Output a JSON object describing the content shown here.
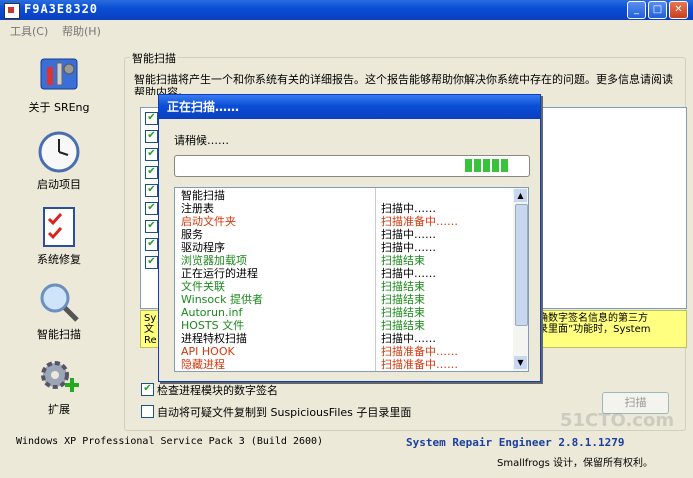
{
  "window": {
    "title": "F9A3E8320",
    "min_glyph": "_",
    "max_glyph": "□",
    "close_glyph": "✕"
  },
  "menu": [
    "工具(C)",
    "帮助(H)"
  ],
  "sidebar": [
    {
      "label": "关于 SREng",
      "icon": "about-tools-icon"
    },
    {
      "label": "启动项目",
      "icon": "clock-icon"
    },
    {
      "label": "系统修复",
      "icon": "checklist-icon"
    },
    {
      "label": "智能扫描",
      "icon": "magnifier-icon"
    },
    {
      "label": "扩展",
      "icon": "gear-plus-icon"
    }
  ],
  "main": {
    "group_title": "智能扫描",
    "intro": "智能扫描将产生一个和你系统有关的详细报告。这个报告能够帮助你解决你系统中存在的问题。更多信息请阅读帮助内容。",
    "yellow_note": {
      "line1_left": "Sy",
      "line1_right": "确数字签名信息的第三方",
      "line2_left": "文",
      "line2_right": "录里面”功能时，System",
      "line3_left": "Re"
    },
    "option_signature": "检查进程模块的数字签名",
    "option_copy": "自动将可疑文件复制到 SuspiciousFiles 子目录里面",
    "scan_button": "扫描"
  },
  "status": {
    "os": "Windows XP Professional Service Pack 3 (Build 2600)",
    "product": "System Repair Engineer 2.8.1.1279",
    "credit": "Smallfrogs 设计，保留所有权利。",
    "watermark": "51CTO.com"
  },
  "dialog": {
    "title": "正在扫描……",
    "wait": "请稍候……",
    "progress": 0.2,
    "rows": [
      {
        "name": "智能扫描",
        "status": "",
        "color": "#000000"
      },
      {
        "name": "注册表",
        "status": "扫描中……",
        "color": "#000000"
      },
      {
        "name": "启动文件夹",
        "status": "扫描准备中……",
        "color": "#d4380d"
      },
      {
        "name": "服务",
        "status": "扫描中……",
        "color": "#000000"
      },
      {
        "name": "驱动程序",
        "status": "扫描中……",
        "color": "#000000"
      },
      {
        "name": "浏览器加载项",
        "status": "扫描结束",
        "color": "#1a8a1a"
      },
      {
        "name": "正在运行的进程",
        "status": "扫描中……",
        "color": "#000000"
      },
      {
        "name": "文件关联",
        "status": "扫描结束",
        "color": "#1a8a1a"
      },
      {
        "name": "Winsock 提供者",
        "status": "扫描结束",
        "color": "#1a8a1a"
      },
      {
        "name": "Autorun.inf",
        "status": "扫描结束",
        "color": "#1a8a1a"
      },
      {
        "name": "HOSTS 文件",
        "status": "扫描结束",
        "color": "#1a8a1a"
      },
      {
        "name": "进程特权扫描",
        "status": "扫描中……",
        "color": "#000000"
      },
      {
        "name": "API HOOK",
        "status": "扫描准备中……",
        "color": "#d4380d"
      },
      {
        "name": "隐藏进程",
        "status": "扫描准备中……",
        "color": "#d4380d"
      }
    ]
  }
}
